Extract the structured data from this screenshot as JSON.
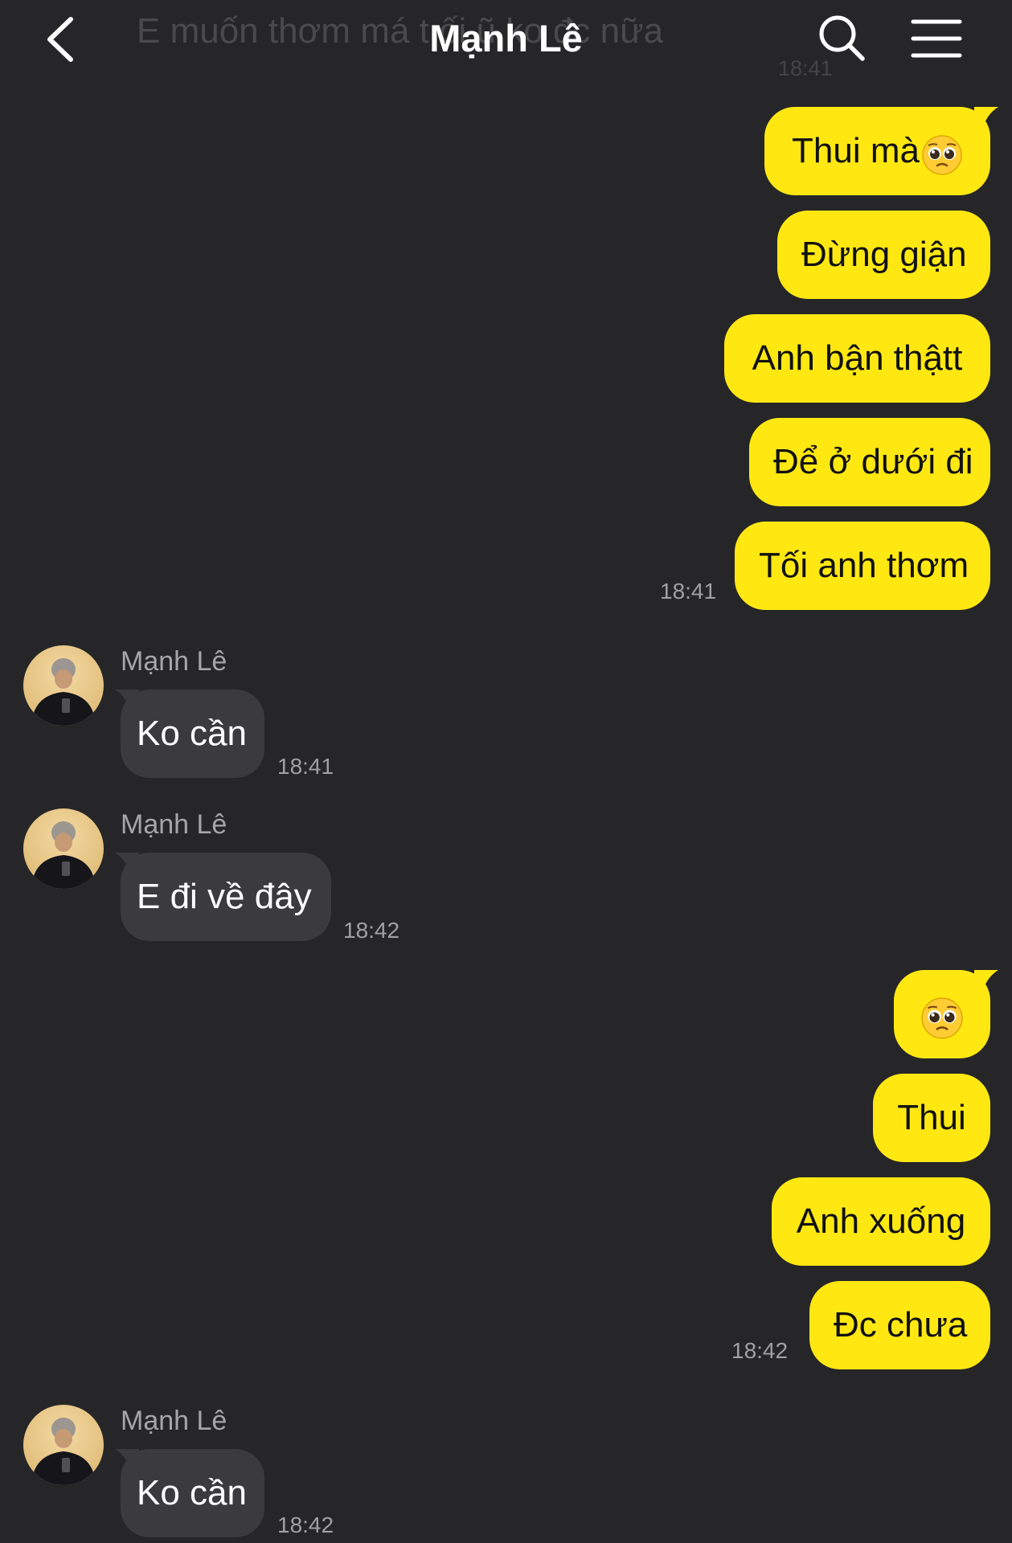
{
  "header": {
    "title": "Mạnh Lê",
    "behind_preview": "E muốn thơm má t    ối    ũ    ko đc nữa",
    "behind_time": "18:41"
  },
  "messages": {
    "out1": {
      "text": "Thui mà",
      "emoji": "pleading-face"
    },
    "out2": {
      "text": "Đừng giận"
    },
    "out3": {
      "text": "Anh bận thậtt"
    },
    "out4": {
      "text": "Để ở dưới đi"
    },
    "out5": {
      "text": "Tối anh thơm",
      "time": "18:41"
    },
    "in1": {
      "sender": "Mạnh Lê",
      "text": "Ko cần",
      "time": "18:41"
    },
    "in2": {
      "sender": "Mạnh Lê",
      "text": "E đi về đây",
      "time": "18:42"
    },
    "out6": {
      "emoji": "pleading-face"
    },
    "out7": {
      "text": "Thui"
    },
    "out8": {
      "text": "Anh xuống"
    },
    "out9": {
      "text": "Đc chưa",
      "time": "18:42"
    },
    "in3": {
      "sender": "Mạnh Lê",
      "text": "Ko cần",
      "time": "18:42"
    }
  },
  "colors": {
    "background": "#262628",
    "outgoing_bubble": "#ffe812",
    "incoming_bubble": "#3b3b3d"
  }
}
